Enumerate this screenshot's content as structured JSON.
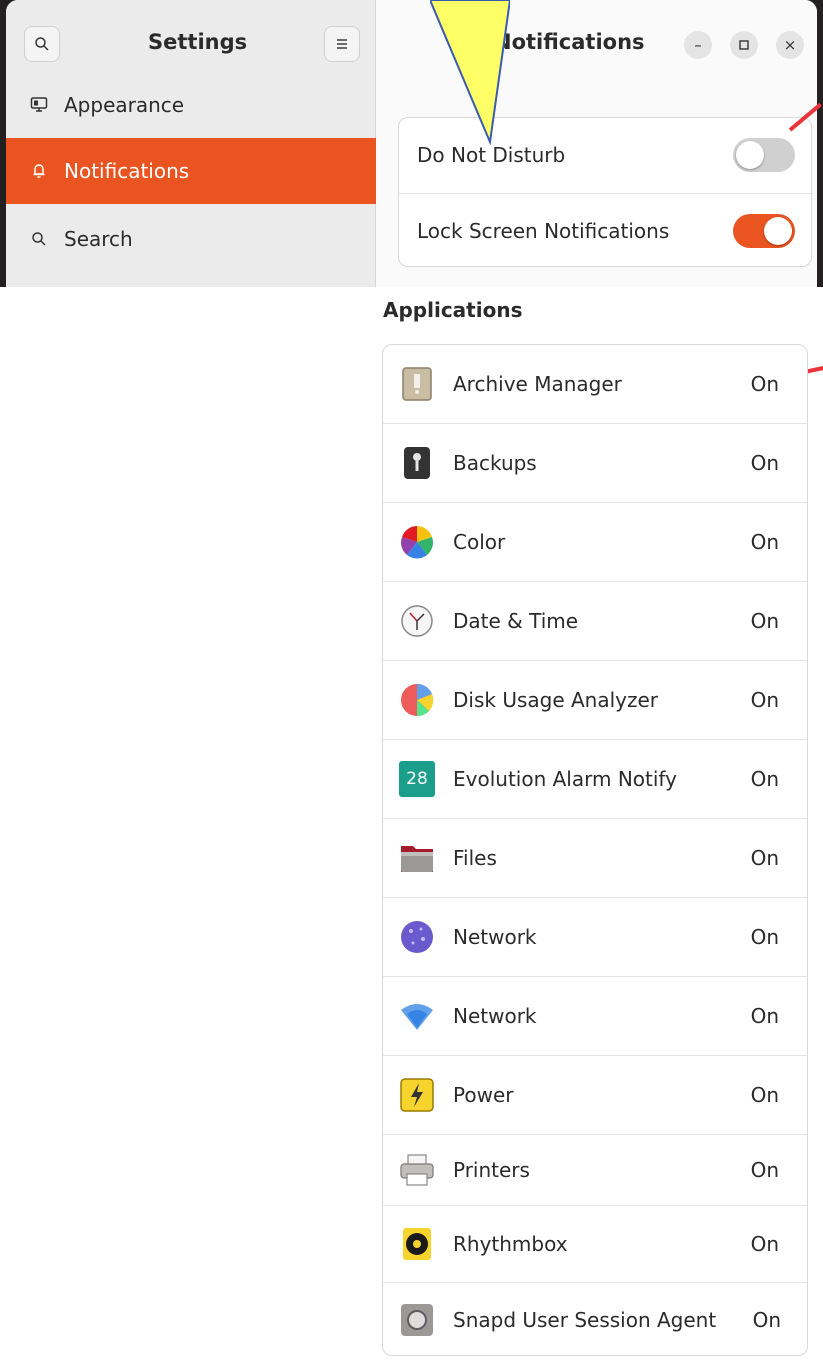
{
  "sidebar": {
    "title": "Settings",
    "items": [
      {
        "label": "Appearance",
        "icon": "appearance-icon",
        "active": false
      },
      {
        "label": "Notifications",
        "icon": "bell-icon",
        "active": true
      },
      {
        "label": "Search",
        "icon": "search-icon",
        "active": false
      }
    ]
  },
  "content": {
    "title": "Notifications",
    "toggles": [
      {
        "label": "Do Not Disturb",
        "on": false
      },
      {
        "label": "Lock Screen Notifications",
        "on": true
      }
    ],
    "applications_heading": "Applications",
    "applications": [
      {
        "name": "Archive Manager",
        "state": "On",
        "icon": "archive-manager-icon"
      },
      {
        "name": "Backups",
        "state": "On",
        "icon": "backups-icon"
      },
      {
        "name": "Color",
        "state": "On",
        "icon": "color-icon"
      },
      {
        "name": "Date & Time",
        "state": "On",
        "icon": "clock-icon"
      },
      {
        "name": "Disk Usage Analyzer",
        "state": "On",
        "icon": "disk-usage-icon"
      },
      {
        "name": "Evolution Alarm Notify",
        "state": "On",
        "icon": "calendar-icon",
        "icon_text": "28"
      },
      {
        "name": "Files",
        "state": "On",
        "icon": "folder-icon"
      },
      {
        "name": "Network",
        "state": "On",
        "icon": "network-globe-icon"
      },
      {
        "name": "Network",
        "state": "On",
        "icon": "wifi-icon"
      },
      {
        "name": "Power",
        "state": "On",
        "icon": "power-icon"
      },
      {
        "name": "Printers",
        "state": "On",
        "icon": "printer-icon"
      },
      {
        "name": "Rhythmbox",
        "state": "On",
        "icon": "rhythmbox-icon"
      },
      {
        "name": "Snapd User Session Agent",
        "state": "On",
        "icon": "snapd-icon"
      }
    ]
  },
  "colors": {
    "accent": "#e95420",
    "annotation_pointer": "#ffff66",
    "annotation_red": "#e8343a"
  }
}
